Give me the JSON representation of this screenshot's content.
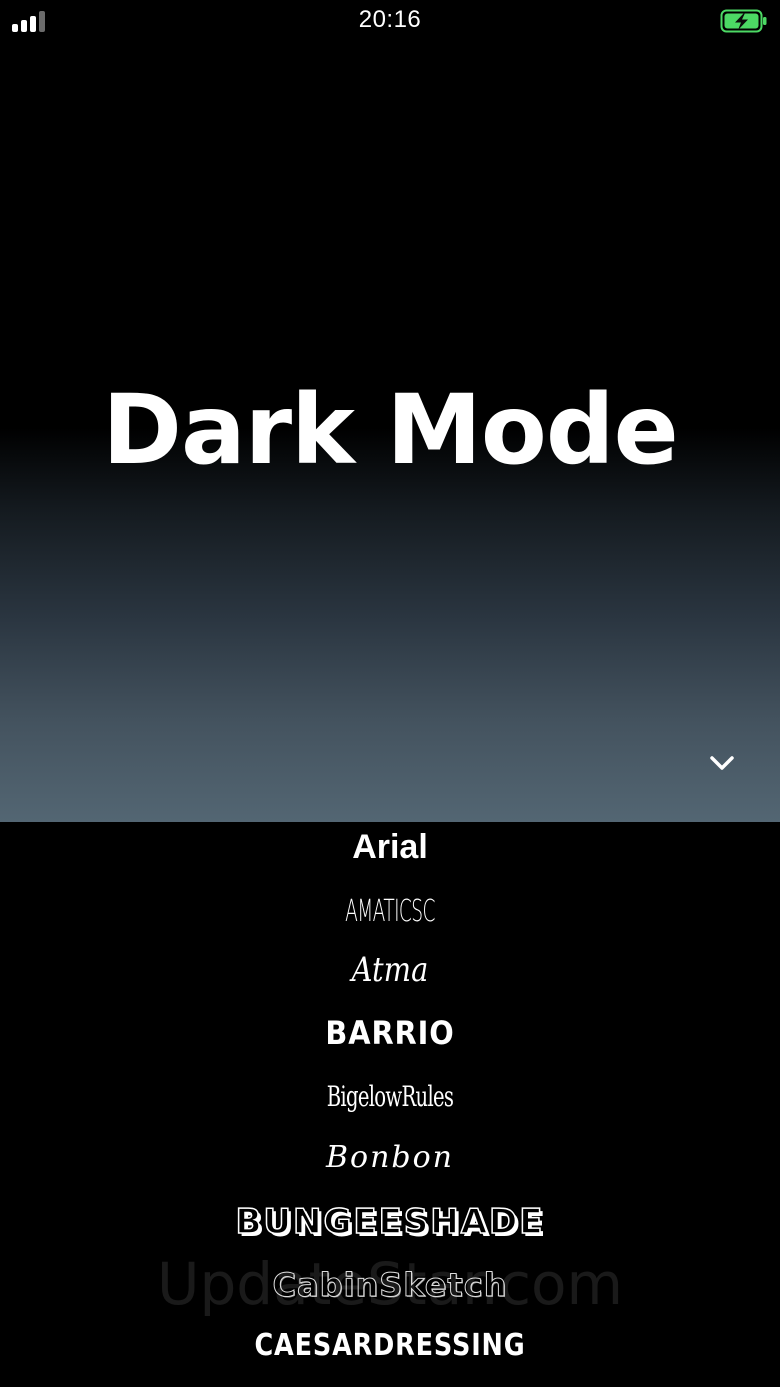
{
  "status_bar": {
    "time": "20:16",
    "signal_icon": "signal-bars-icon",
    "battery_icon": "battery-charging-icon",
    "battery_color": "#4cd964"
  },
  "preview": {
    "text": "Dark Mode",
    "gradient_top": "#000000",
    "gradient_bottom": "#536673",
    "collapse_icon": "chevron-down-icon"
  },
  "font_list": {
    "items": [
      "Arial",
      "AMATICSC",
      "Atma",
      "BARRIO",
      "BigelowRules",
      "Bonbon",
      "BUNGEESHADE",
      "CabinSketch",
      "CAESARDRESSING"
    ]
  },
  "watermark": "UpdateStar.com"
}
